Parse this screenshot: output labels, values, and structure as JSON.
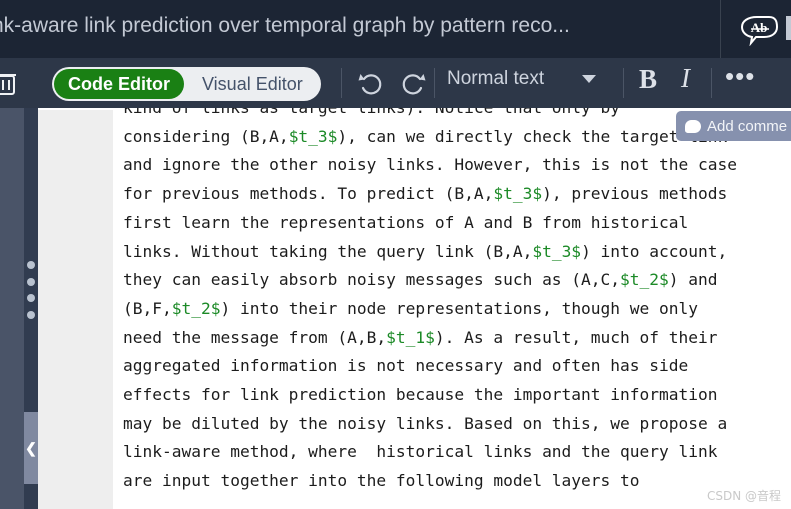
{
  "header": {
    "title": "nk-aware link prediction over temporal graph by pattern reco...",
    "spellcheck_icon_label": "Ab",
    "icon_name": "spellcheck-icon"
  },
  "toolbar": {
    "delete_icon": "trash-icon",
    "editor_toggle": {
      "code_editor_label": "Code Editor",
      "visual_editor_label": "Visual Editor",
      "active": "Code Editor"
    },
    "undo_label": "↶",
    "redo_label": "↷",
    "style_select_value": "Normal text",
    "bold_label": "B",
    "italic_label": "I",
    "more_label": "•••"
  },
  "sidebar": {
    "collapse_label": "❮",
    "drag_handle_name": "vertical-drag-handle"
  },
  "comment": {
    "add_comment_label": "Add comme"
  },
  "editor": {
    "lines": [
      [
        {
          "t": "kind of links as target links). Notice that only by",
          "v": false
        }
      ],
      [
        {
          "t": "considering (B,A,",
          "v": false
        },
        {
          "t": "$t_3$",
          "v": true
        },
        {
          "t": "), can we directly check the target link",
          "v": false
        }
      ],
      [
        {
          "t": "and ignore the other noisy links. However, this is not the case",
          "v": false
        }
      ],
      [
        {
          "t": "for previous methods. To predict (B,A,",
          "v": false
        },
        {
          "t": "$t_3$",
          "v": true
        },
        {
          "t": "), previous methods",
          "v": false
        }
      ],
      [
        {
          "t": "first learn the representations of A and B from historical",
          "v": false
        }
      ],
      [
        {
          "t": "links. Without taking the query link (B,A,",
          "v": false
        },
        {
          "t": "$t_3$",
          "v": true
        },
        {
          "t": ") into account,",
          "v": false
        }
      ],
      [
        {
          "t": "they can easily absorb noisy messages such as (A,C,",
          "v": false
        },
        {
          "t": "$t_2$",
          "v": true
        },
        {
          "t": ") and",
          "v": false
        }
      ],
      [
        {
          "t": "(B,F,",
          "v": false
        },
        {
          "t": "$t_2$",
          "v": true
        },
        {
          "t": ") into their node representations, though we only",
          "v": false
        }
      ],
      [
        {
          "t": "need the message from (A,B,",
          "v": false
        },
        {
          "t": "$t_1$",
          "v": true
        },
        {
          "t": "). As a result, much of their",
          "v": false
        }
      ],
      [
        {
          "t": "aggregated information is not necessary and often has side",
          "v": false
        }
      ],
      [
        {
          "t": "effects for link prediction because the important information",
          "v": false
        }
      ],
      [
        {
          "t": "may be diluted by the noisy links. Based on this, we propose a",
          "v": false
        }
      ],
      [
        {
          "t": "link-aware method, where  historical links and the query link",
          "v": false
        }
      ],
      [
        {
          "t": "are input together into the following model layers to",
          "v": false
        }
      ]
    ]
  },
  "watermark": {
    "text": "CSDN @音程"
  },
  "colors": {
    "header_bg": "#1c2534",
    "toolbar_bg": "#2d3748",
    "accent_green": "#1a8014",
    "rail_bg": "#4a5468",
    "rail_inner_bg": "#313c50",
    "gutter_bg": "#eeeeee",
    "variable_green": "#1c8a27",
    "comment_bg": "#8691ae"
  }
}
